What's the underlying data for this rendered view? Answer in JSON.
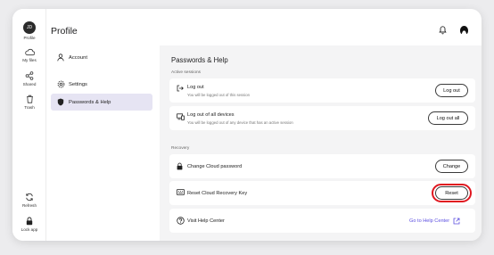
{
  "rail": {
    "profile_avatar": "JD",
    "profile_label": "Profile",
    "items": [
      {
        "label": "My files",
        "icon": "cloud-icon"
      },
      {
        "label": "Shared",
        "icon": "share-icon"
      },
      {
        "label": "Trash",
        "icon": "trash-icon"
      }
    ],
    "refresh_label": "Refresh",
    "lock_label": "Lock app"
  },
  "header": {
    "title": "Profile"
  },
  "nav": {
    "items": [
      {
        "label": "Account",
        "icon": "user-icon"
      },
      {
        "label": "Settings",
        "icon": "gear-icon"
      },
      {
        "label": "Passwords & Help",
        "icon": "shield-icon"
      }
    ],
    "active_index": 2
  },
  "main": {
    "title": "Passwords & Help",
    "active_sessions": {
      "label": "Active sessions",
      "rows": [
        {
          "title": "Log out",
          "subtitle": "You will be logged out of this session",
          "button": "Log out"
        },
        {
          "title": "Log out of all devices",
          "subtitle": "You will be logged out of any device that has an active session",
          "button": "Log out all"
        }
      ]
    },
    "recovery": {
      "label": "Recovery",
      "rows": [
        {
          "title": "Change Cloud password",
          "button": "Change"
        },
        {
          "title": "Reset Cloud Recovery Key",
          "button": "Reset"
        },
        {
          "title": "Visit Help Center",
          "link": "Go to Help Center"
        }
      ]
    }
  },
  "colors": {
    "accent": "#5b4ee0",
    "active_nav_bg": "#e6e4f3",
    "highlight_ring": "#e0161f"
  }
}
